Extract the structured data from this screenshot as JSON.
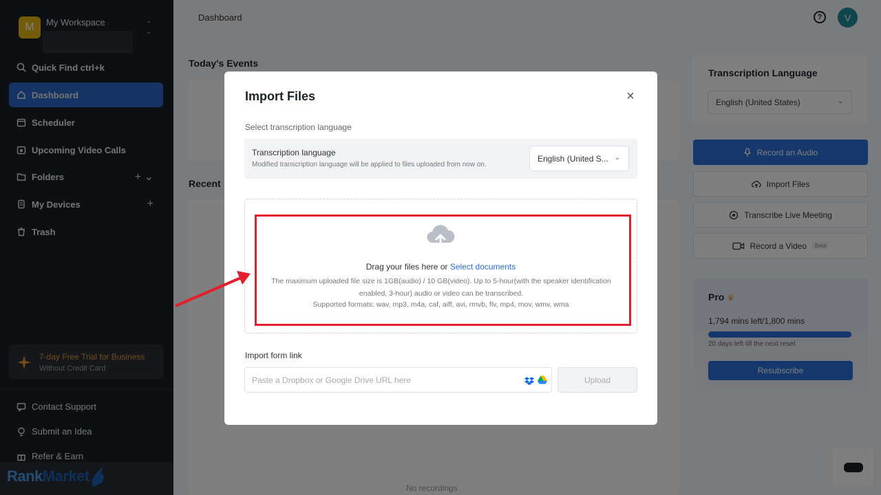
{
  "sidebar": {
    "workspace_initial": "M",
    "workspace_name": "My Workspace",
    "nav": [
      {
        "label": "Quick Find ctrl+k",
        "icon": "search-icon"
      },
      {
        "label": "Dashboard",
        "icon": "home-icon",
        "active": true
      },
      {
        "label": "Scheduler",
        "icon": "calendar-icon"
      },
      {
        "label": "Upcoming Video Calls",
        "icon": "video-call-icon"
      },
      {
        "label": "Folders",
        "icon": "folder-icon",
        "right": "+  ⌄"
      },
      {
        "label": "My Devices",
        "icon": "device-icon",
        "right": "+"
      },
      {
        "label": "Trash",
        "icon": "trash-icon"
      }
    ],
    "trial": {
      "title": "7-day Free Trial for Business",
      "subtitle": "Without Credit Card"
    },
    "footer": [
      {
        "label": "Contact Support",
        "icon": "support-icon"
      },
      {
        "label": "Submit an Idea",
        "icon": "bulb-icon"
      },
      {
        "label": "Refer & Earn",
        "icon": "gift-icon"
      }
    ]
  },
  "header": {
    "breadcrumb": "Dashboard",
    "user_initial": "V"
  },
  "main": {
    "todays_events": "Today's Events",
    "recent": "Recent",
    "no_recordings": "No recordings"
  },
  "right_panel": {
    "lang_title": "Transcription Language",
    "lang_value": "English (United States)",
    "buttons": {
      "record_audio": "Record an Audio",
      "import_files": "Import Files",
      "transcribe_live": "Transcribe Live Meeting",
      "record_video": "Record a Video",
      "beta": "Beta"
    },
    "pro": {
      "title": "Pro",
      "mins": "1,794 mins left/1,800 mins",
      "used_fraction": 0.997,
      "reset": "20 days left till the next reset",
      "resubscribe": "Resubscribe"
    }
  },
  "modal": {
    "title": "Import Files",
    "subtitle": "Select transcription language",
    "lang_row_title": "Transcription language",
    "lang_row_sub": "Modified transcription language will be applied to files uploaded from now on.",
    "lang_value": "English (United S...",
    "drag_text": "Drag your files here or",
    "select_link": "Select documents",
    "limits": "The maximum uploaded file size is 1GB(audio) / 10 GB(video). Up to 5-hour(with the speaker identification enabled, 3-hour) audio or video can be transcribed.",
    "formats": "Supported formats: wav, mp3, m4a, caf, aiff, avi, rmvb, flv, mp4, mov, wmv, wma",
    "link_title": "Import form link",
    "url_placeholder": "Paste a Dropbox or Google Drive URL here",
    "upload": "Upload"
  },
  "watermark": {
    "part1": "Rank",
    "part2": "Market"
  },
  "colors": {
    "accent": "#2b6fd6",
    "sidebar_bg": "#1b1f27",
    "highlight": "#e31f2d",
    "trial": "#e09a3a"
  }
}
